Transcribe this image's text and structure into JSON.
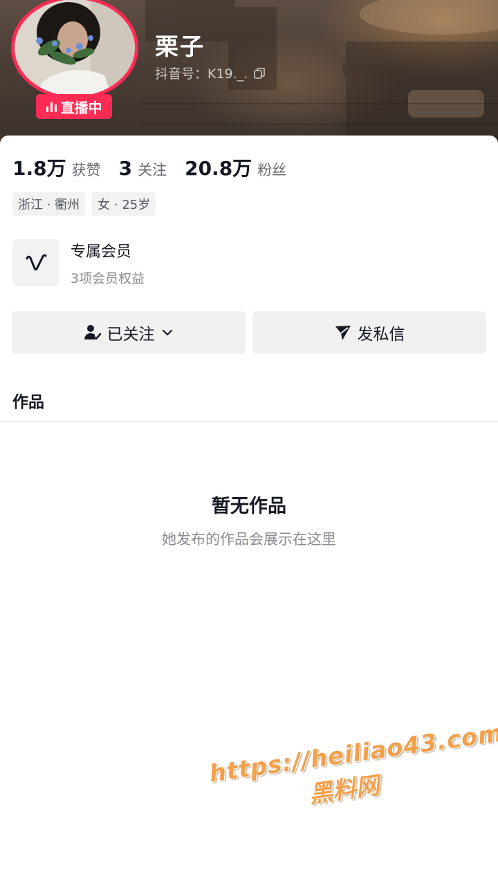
{
  "profile": {
    "nickname": "栗子",
    "douyin_id": "抖音号：K19._.",
    "live_badge": "直播中"
  },
  "stats": [
    {
      "value": "1.8万",
      "label": "获赞"
    },
    {
      "value": "3",
      "label": "关注"
    },
    {
      "value": "20.8万",
      "label": "粉丝"
    }
  ],
  "tags": [
    "浙江 · 衢州",
    "女 · 25岁"
  ],
  "membership": {
    "title": "专属会员",
    "subtitle": "3项会员权益"
  },
  "actions": {
    "follow_label": "已关注",
    "message_label": "发私信"
  },
  "works": {
    "tab_label": "作品",
    "empty_title": "暂无作品",
    "empty_subtitle": "她发布的作品会展示在这里"
  },
  "watermark": {
    "url": "https://heiliao43.com",
    "site": "黑料网"
  },
  "colors": {
    "accent": "#fe2c55",
    "watermark": "#f3a04b"
  },
  "icons": {
    "live": "live-bars-icon",
    "copy": "copy-icon",
    "member": "v-member-icon",
    "follow": "user-check-icon",
    "dropdown": "chevron-down-icon",
    "message": "send-icon"
  }
}
